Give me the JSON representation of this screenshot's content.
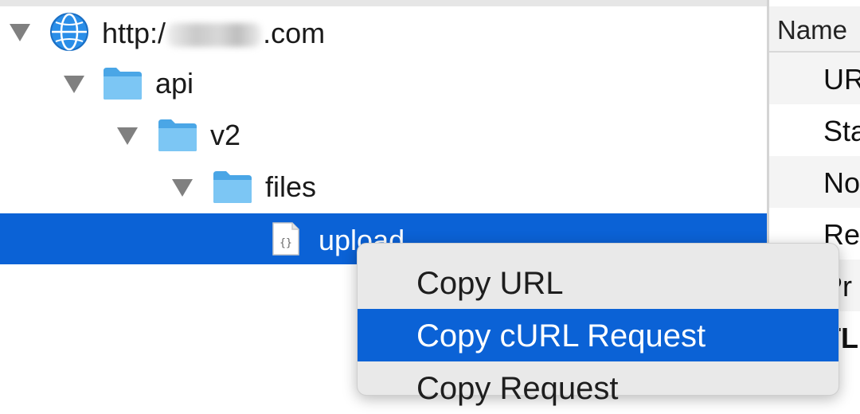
{
  "tree": {
    "host": {
      "prefix": "http:/",
      "suffix": ".com"
    },
    "nodes": [
      {
        "label": "api"
      },
      {
        "label": "v2"
      },
      {
        "label": "files"
      },
      {
        "label": "upload"
      }
    ]
  },
  "inspector": {
    "header": "Name",
    "rows": [
      "UR",
      "Sta",
      "No",
      "Re",
      "Pr",
      "TL"
    ]
  },
  "context_menu": {
    "items": [
      "Copy URL",
      "Copy cURL Request",
      "Copy Request"
    ]
  },
  "colors": {
    "selection": "#0b62d6",
    "folder": "#5db4ee",
    "globe": "#2a8ee8"
  }
}
